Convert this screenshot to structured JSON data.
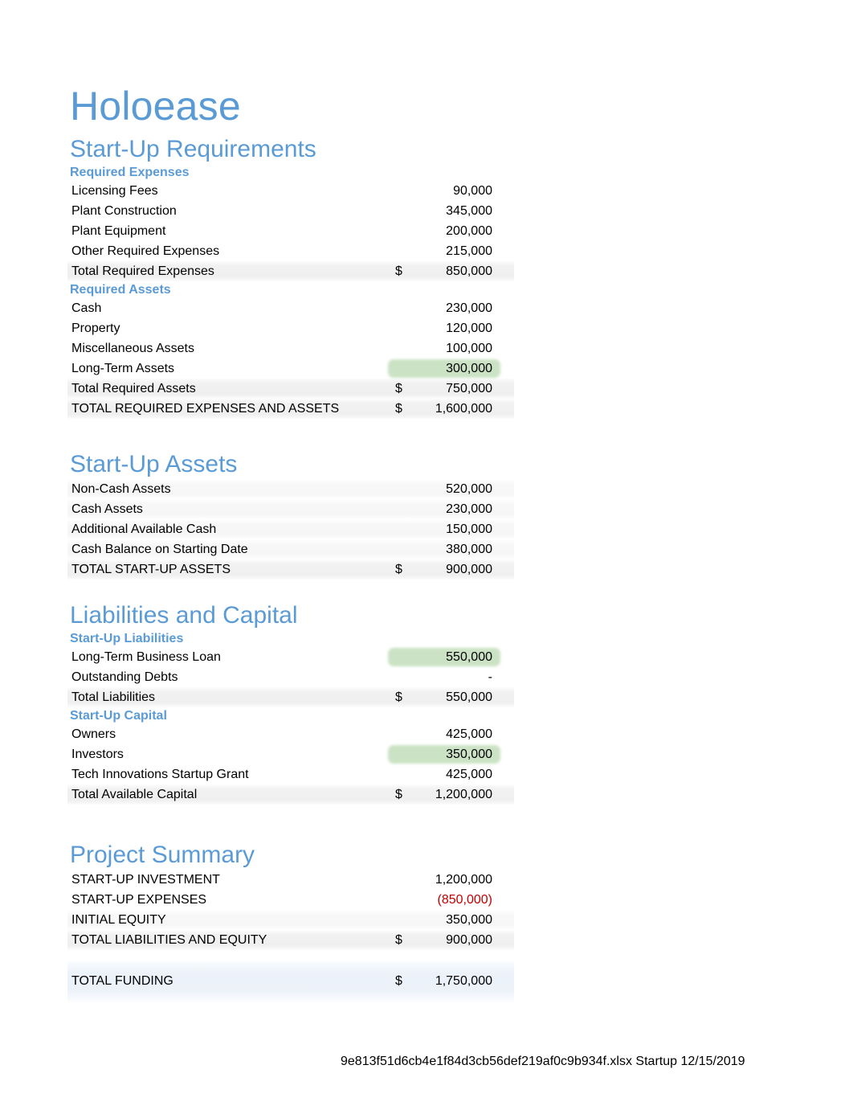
{
  "document": {
    "company_title": "Holoease",
    "footer": "9e813f51d6cb4e1f84d3cb56def219af0c9b934f.xlsx Startup 12/15/2019",
    "currency_symbol": "$",
    "colors": {
      "heading_blue": "#5B9BD5",
      "negative_red": "#C00000",
      "highlight_green": "#CBE3C4",
      "total_band_gray": "#ECECEC",
      "funding_band_blue": "#ECF2F9"
    }
  },
  "sections": [
    {
      "title": "Start-Up Requirements",
      "groups": [
        {
          "subhead": "Required Expenses",
          "rows": [
            {
              "label": "Licensing Fees",
              "currency": "",
              "value": "90,000",
              "band": "none",
              "highlight": false
            },
            {
              "label": "Plant Construction",
              "currency": "",
              "value": "345,000",
              "band": "none",
              "highlight": false
            },
            {
              "label": "Plant Equipment",
              "currency": "",
              "value": "200,000",
              "band": "none",
              "highlight": false
            },
            {
              "label": "Other Required Expenses",
              "currency": "",
              "value": "215,000",
              "band": "none",
              "highlight": false
            },
            {
              "label": "Total Required Expenses",
              "currency": "$",
              "value": "850,000",
              "band": "total",
              "highlight": false
            }
          ]
        },
        {
          "subhead": "Required Assets",
          "rows": [
            {
              "label": "Cash",
              "currency": "",
              "value": "230,000",
              "band": "none",
              "highlight": false
            },
            {
              "label": "Property",
              "currency": "",
              "value": "120,000",
              "band": "none",
              "highlight": false
            },
            {
              "label": "Miscellaneous Assets",
              "currency": "",
              "value": "100,000",
              "band": "none",
              "highlight": false
            },
            {
              "label": "Long-Term Assets",
              "currency": "",
              "value": "300,000",
              "band": "none",
              "highlight": true
            },
            {
              "label": "Total Required Assets",
              "currency": "$",
              "value": "750,000",
              "band": "total",
              "highlight": false
            },
            {
              "label": "TOTAL REQUIRED EXPENSES AND ASSETS",
              "currency": "$",
              "value": "1,600,000",
              "band": "total",
              "highlight": false
            }
          ]
        }
      ]
    },
    {
      "title": "Start-Up Assets",
      "groups": [
        {
          "subhead": "",
          "rows": [
            {
              "label": "Non-Cash Assets",
              "currency": "",
              "value": "520,000",
              "band": "soft",
              "highlight": false
            },
            {
              "label": "Cash Assets",
              "currency": "",
              "value": "230,000",
              "band": "soft",
              "highlight": false
            },
            {
              "label": "Additional Available Cash",
              "currency": "",
              "value": "150,000",
              "band": "soft",
              "highlight": false
            },
            {
              "label": "Cash Balance on Starting Date",
              "currency": "",
              "value": "380,000",
              "band": "soft",
              "highlight": false
            },
            {
              "label": "TOTAL START-UP ASSETS",
              "currency": "$",
              "value": "900,000",
              "band": "total",
              "highlight": false
            }
          ]
        }
      ]
    },
    {
      "title": "Liabilities and Capital",
      "groups": [
        {
          "subhead": "Start-Up Liabilities",
          "rows": [
            {
              "label": "Long-Term Business Loan",
              "currency": "",
              "value": "550,000",
              "band": "none",
              "highlight": true
            },
            {
              "label": "Outstanding Debts",
              "currency": "",
              "value": "-",
              "band": "none",
              "highlight": false
            },
            {
              "label": "Total Liabilities",
              "currency": "$",
              "value": "550,000",
              "band": "total",
              "highlight": false
            }
          ]
        },
        {
          "subhead": "Start-Up Capital",
          "rows": [
            {
              "label": "Owners",
              "currency": "",
              "value": "425,000",
              "band": "none",
              "highlight": false
            },
            {
              "label": "Investors",
              "currency": "",
              "value": "350,000",
              "band": "none",
              "highlight": true
            },
            {
              "label": "Tech Innovations Startup Grant",
              "currency": "",
              "value": "425,000",
              "band": "none",
              "highlight": false
            },
            {
              "label": "Total Available Capital",
              "currency": "$",
              "value": "1,200,000",
              "band": "total",
              "highlight": false
            }
          ]
        }
      ]
    },
    {
      "title": "Project Summary",
      "groups": [
        {
          "subhead": "",
          "rows": [
            {
              "label": "START-UP INVESTMENT",
              "currency": "",
              "value": "1,200,000",
              "band": "none",
              "highlight": false,
              "negative": false
            },
            {
              "label": "START-UP EXPENSES",
              "currency": "",
              "value": "(850,000)",
              "band": "none",
              "highlight": false,
              "negative": true
            },
            {
              "label": "INITIAL EQUITY",
              "currency": "",
              "value": "350,000",
              "band": "soft",
              "highlight": false,
              "negative": false
            },
            {
              "label": "TOTAL LIABILITIES AND EQUITY",
              "currency": "$",
              "value": "900,000",
              "band": "total",
              "highlight": false,
              "negative": false
            }
          ]
        },
        {
          "subhead": "",
          "rows": [
            {
              "label": "TOTAL FUNDING",
              "currency": "$",
              "value": "1,750,000",
              "band": "blue",
              "highlight": false,
              "negative": false
            }
          ]
        }
      ]
    }
  ]
}
